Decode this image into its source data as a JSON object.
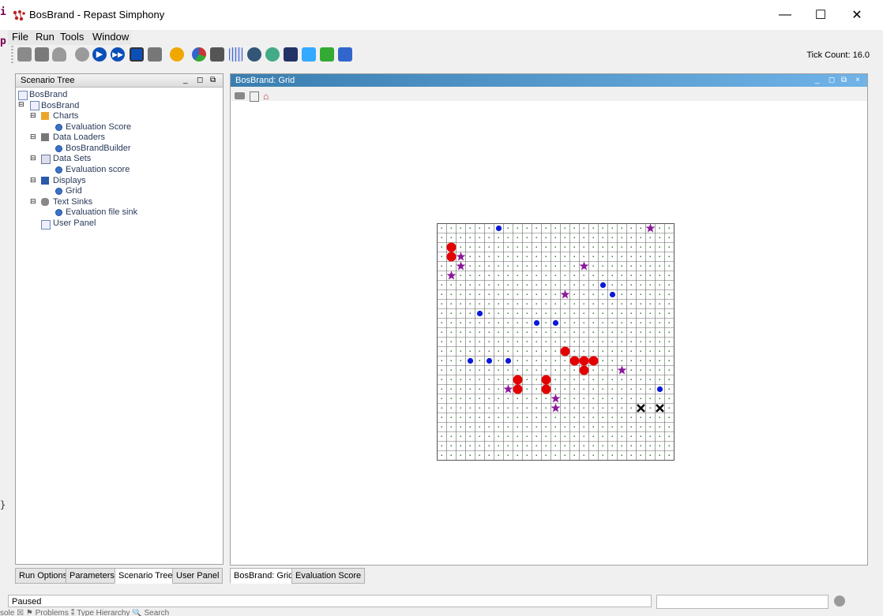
{
  "window": {
    "title": "BosBrand - Repast Simphony",
    "minimize": "—",
    "maximize": "☐",
    "close": "✕"
  },
  "menu": [
    "File",
    "Run",
    "Tools",
    "Window"
  ],
  "toolbar": {
    "tick_label": "Tick Count: 16.0"
  },
  "scenario_tree": {
    "title": "Scenario Tree",
    "items": [
      {
        "label": "BosBrand"
      },
      {
        "label": "BosBrand"
      },
      {
        "label": "Charts"
      },
      {
        "label": "Evaluation Score"
      },
      {
        "label": "Data Loaders"
      },
      {
        "label": "BosBrandBuilder"
      },
      {
        "label": "Data Sets"
      },
      {
        "label": "Evaluation score"
      },
      {
        "label": "Displays"
      },
      {
        "label": "Grid"
      },
      {
        "label": "Text Sinks"
      },
      {
        "label": "Evaluation file sink"
      },
      {
        "label": "User Panel"
      }
    ]
  },
  "left_tabs": [
    "Run Options",
    "Parameters",
    "Scenario Tree",
    "User Panel"
  ],
  "display": {
    "title": "BosBrand: Grid",
    "grid": {
      "cols": 25,
      "rows": 25,
      "blue_dots": [
        [
          6,
          0
        ],
        [
          17,
          6
        ],
        [
          18,
          7
        ],
        [
          4,
          9
        ],
        [
          10,
          10
        ],
        [
          12,
          10
        ],
        [
          3,
          14
        ],
        [
          5,
          14
        ],
        [
          7,
          14
        ],
        [
          23,
          17
        ]
      ],
      "red_blobs": [
        [
          1,
          2
        ],
        [
          1,
          3
        ],
        [
          13,
          13
        ],
        [
          14,
          14
        ],
        [
          15,
          14
        ],
        [
          16,
          14
        ],
        [
          15,
          15
        ],
        [
          8,
          16
        ],
        [
          8,
          17
        ],
        [
          11,
          16
        ],
        [
          11,
          17
        ]
      ],
      "stars": [
        [
          22,
          0
        ],
        [
          2,
          3
        ],
        [
          2,
          4
        ],
        [
          15,
          4
        ],
        [
          1,
          5
        ],
        [
          13,
          7
        ],
        [
          19,
          15
        ],
        [
          7,
          17
        ],
        [
          12,
          18
        ],
        [
          12,
          19
        ]
      ],
      "crosses": [
        [
          21,
          19
        ],
        [
          23,
          19
        ]
      ]
    }
  },
  "right_tabs": [
    "BosBrand: Grid",
    "Evaluation Score"
  ],
  "status": {
    "text": "Paused"
  },
  "bottom_fragment": "sole ☒  ⚑ Problems  ⁑ Type Hierarchy  🔍 Search"
}
